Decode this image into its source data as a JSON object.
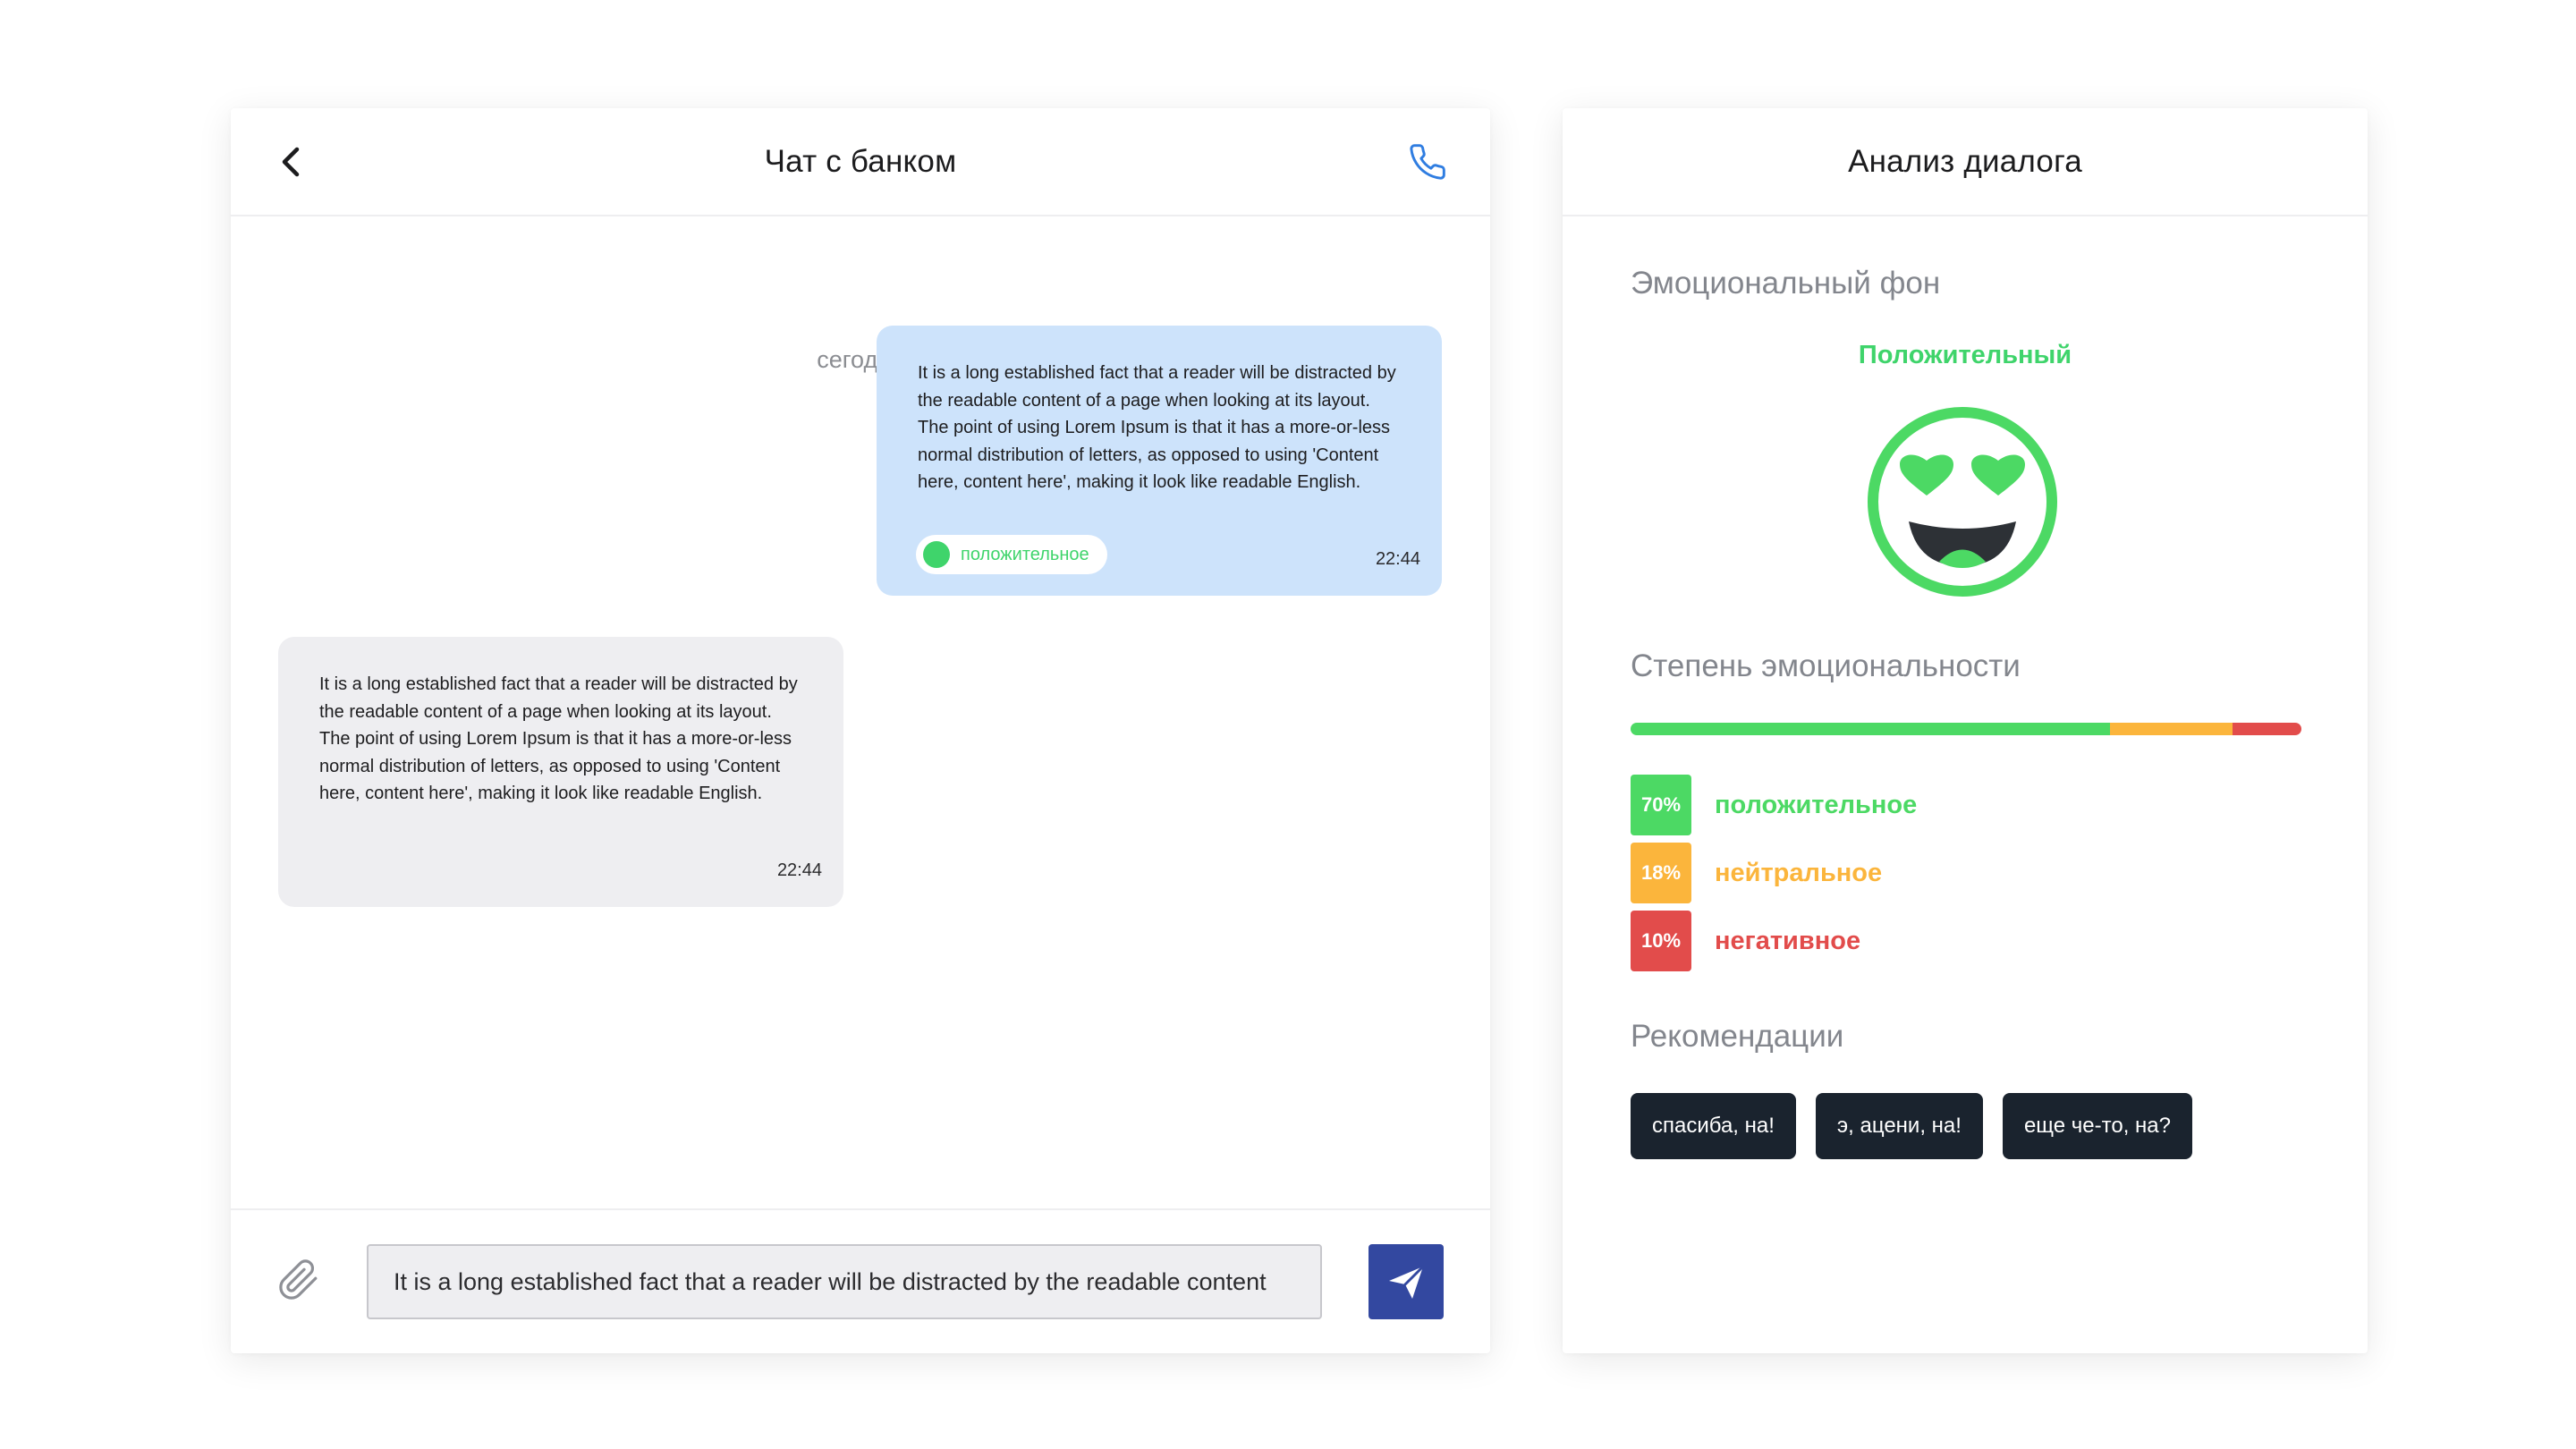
{
  "chat": {
    "title": "Чат с банком",
    "date_separator": "сегодня",
    "messages": [
      {
        "direction": "outgoing",
        "text": "It is a long established fact that a reader will be distracted by the readable content of a page when looking at its layout. The point of using Lorem Ipsum is that it has a more-or-less normal distribution of letters, as opposed to using 'Content here, content here', making it look like readable English.",
        "time": "22:44",
        "sentiment_label": "положительное"
      },
      {
        "direction": "incoming",
        "text": "It is a long established fact that a reader will be distracted by the readable content of a page when looking at its layout. The point of using Lorem Ipsum is that it has a more-or-less normal distribution of letters, as opposed to using 'Content here, content here', making it look like readable English.",
        "time": "22:44"
      }
    ],
    "composer": {
      "value": "It is a long established fact that a reader will be distracted by the readable content"
    },
    "icons": {
      "back": "chevron-left-icon",
      "call": "phone-icon",
      "attach": "paperclip-icon",
      "send": "paper-plane-icon"
    },
    "colors": {
      "outgoing_bubble": "#cde3fb",
      "incoming_bubble": "#eeeef1",
      "send_button": "#3348a0",
      "accent_blue": "#2f7de1"
    }
  },
  "analysis": {
    "title": "Анализ диалога",
    "emotional_background": {
      "heading": "Эмоциональный фон",
      "value": "Положительный",
      "icon": "heart-eyes-emoji-icon"
    },
    "emotionality": {
      "heading": "Степень эмоциональности",
      "segments": [
        {
          "pct": "70%",
          "value": 70,
          "label": "положительное",
          "color": "#4cd964"
        },
        {
          "pct": "18%",
          "value": 18,
          "label": "нейтральное",
          "color": "#fbb53c"
        },
        {
          "pct": "10%",
          "value": 10,
          "label": "негативное",
          "color": "#e24c4b"
        }
      ]
    },
    "recommendations": {
      "heading": "Рекомендации",
      "items": [
        "спасиба, на!",
        "э, ацени, на!",
        "еще че-то, на?"
      ]
    }
  }
}
